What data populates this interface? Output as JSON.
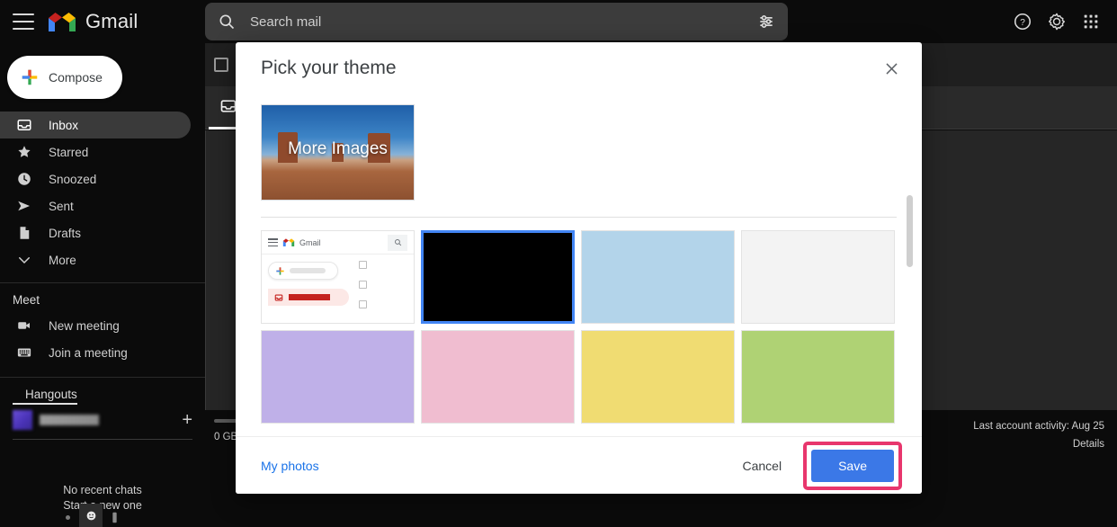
{
  "app": {
    "brand": "Gmail",
    "accent_blue": "#3b78e7",
    "highlight_ring": "#e8366d",
    "topbar_bg": "#0b0b0b"
  },
  "topbar": {
    "menu_icon": "hamburger-menu-icon",
    "logo_icon": "gmail-m-logo-icon",
    "brand_label": "Gmail",
    "search": {
      "icon": "search-icon",
      "placeholder": "Search mail",
      "value": "",
      "options_icon": "tune-filter-icon"
    },
    "actions": [
      {
        "name": "help-icon",
        "label": "Support"
      },
      {
        "name": "gear-icon",
        "label": "Settings"
      },
      {
        "name": "apps-grid-icon",
        "label": "Google apps"
      }
    ]
  },
  "sidebar": {
    "compose": {
      "label": "Compose",
      "icon": "plus-icon"
    },
    "items": [
      {
        "label": "Inbox",
        "icon": "inbox-icon",
        "active": true
      },
      {
        "label": "Starred",
        "icon": "star-icon",
        "active": false
      },
      {
        "label": "Snoozed",
        "icon": "clock-icon",
        "active": false
      },
      {
        "label": "Sent",
        "icon": "send-icon",
        "active": false
      },
      {
        "label": "Drafts",
        "icon": "draft-file-icon",
        "active": false
      },
      {
        "label": "More",
        "icon": "chevron-down-icon",
        "active": false
      }
    ],
    "meet": {
      "title": "Meet",
      "items": [
        {
          "label": "New meeting",
          "icon": "video-camera-icon"
        },
        {
          "label": "Join a meeting",
          "icon": "keyboard-icon"
        }
      ]
    },
    "hangouts": {
      "title": "Hangouts",
      "user_name_redacted": "",
      "add_icon": "plus-icon",
      "empty_line1": "No recent chats",
      "empty_line2": "Start a new one"
    }
  },
  "main": {
    "select_all_icon": "checkbox-icon",
    "tab_primary_icon": "inbox-tab-icon",
    "storage": {
      "label": "0 GB",
      "used_percent": 0
    },
    "account": {
      "activity": "Last account activity: Aug 25",
      "details_link": "Details"
    }
  },
  "dialog": {
    "title": "Pick your theme",
    "close_icon": "close-icon",
    "more_images": {
      "label": "More Images",
      "image_alt": "desert-butte-photo"
    },
    "swatches": [
      {
        "name": "gmail-light-preview",
        "type": "preview",
        "color": "#ffffff",
        "selected": false
      },
      {
        "name": "black-theme",
        "type": "color",
        "color": "#000000",
        "selected": true
      },
      {
        "name": "light-blue-theme",
        "type": "color",
        "color": "#b3d4ea",
        "selected": false
      },
      {
        "name": "white-theme",
        "type": "color",
        "color": "#f3f3f3",
        "selected": false
      },
      {
        "name": "lavender-theme",
        "type": "color",
        "color": "#bfb0e8",
        "selected": false
      },
      {
        "name": "pink-theme",
        "type": "color",
        "color": "#f0bdd0",
        "selected": false
      },
      {
        "name": "yellow-theme",
        "type": "color",
        "color": "#f0dc72",
        "selected": false
      },
      {
        "name": "green-theme",
        "type": "color",
        "color": "#afd274",
        "selected": false
      }
    ],
    "footer": {
      "my_photos": "My photos",
      "cancel": "Cancel",
      "save": "Save",
      "save_highlighted": true
    }
  }
}
